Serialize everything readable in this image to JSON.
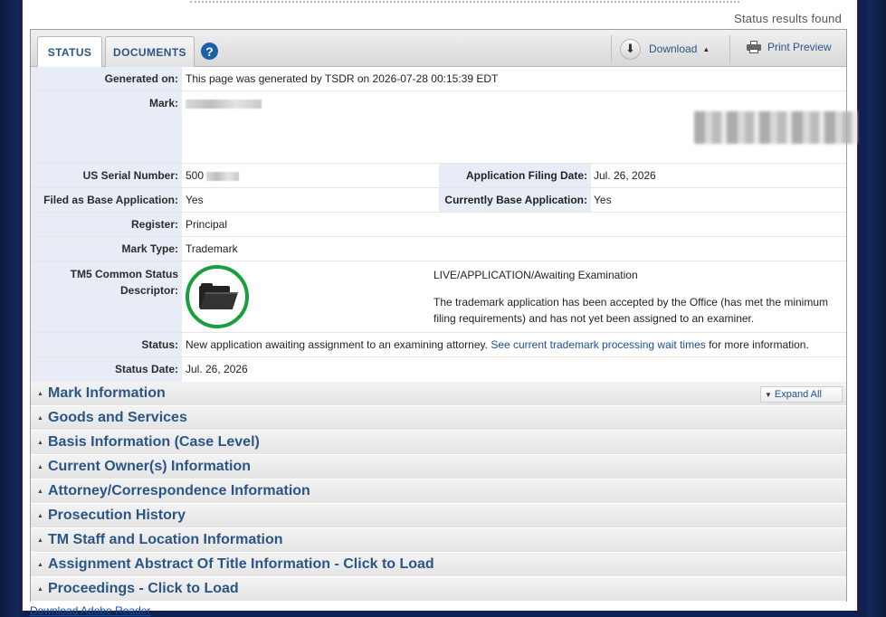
{
  "header": {
    "status_results": "Status results found"
  },
  "tabs": {
    "status": "STATUS",
    "documents": "DOCUMENTS",
    "help": "?"
  },
  "toolbar": {
    "download": "Download",
    "print_preview": "Print Preview"
  },
  "fields": {
    "generated_label": "Generated on:",
    "generated_value": "This page was generated by TSDR on 2026-07-28 00:15:39 EDT",
    "mark_label": "Mark:",
    "serial_label": "US Serial Number:",
    "serial_value": "500",
    "filing_date_label": "Application Filing Date:",
    "filing_date_value": "Jul. 26, 2026",
    "filed_base_label": "Filed as Base Application:",
    "filed_base_value": "Yes",
    "currently_base_label": "Currently Base Application:",
    "currently_base_value": "Yes",
    "register_label": "Register:",
    "register_value": "Principal",
    "mark_type_label": "Mark Type:",
    "mark_type_value": "Trademark",
    "tm5_label_line1": "TM5 Common Status",
    "tm5_label_line2": "Descriptor:",
    "tm5_status": "LIVE/APPLICATION/Awaiting Examination",
    "tm5_description": "The trademark application has been accepted by the Office (has met the minimum filing requirements) and has not yet been assigned to an examiner.",
    "status_label": "Status:",
    "status_text": "New application awaiting assignment to an examining attorney.",
    "status_link": "See current trademark processing wait times",
    "status_suffix": "for more information.",
    "status_date_label": "Status Date:",
    "status_date_value": "Jul. 26, 2026"
  },
  "expand_all": "Expand All",
  "sections": [
    {
      "title": "Mark Information"
    },
    {
      "title": "Goods and Services"
    },
    {
      "title": "Basis Information (Case Level)"
    },
    {
      "title": "Current Owner(s) Information"
    },
    {
      "title": "Attorney/Correspondence Information"
    },
    {
      "title": "Prosecution History"
    },
    {
      "title": "TM Staff and Location Information"
    },
    {
      "title": "Assignment Abstract Of Title Information - Click to Load"
    },
    {
      "title": "Proceedings - Click to Load"
    }
  ],
  "footer": {
    "link": "Download Adobe Reader"
  },
  "colors": {
    "accent": "#2a5685",
    "link": "#1a4fa0",
    "label_bg": "#e8ecf7",
    "tm5_ring": "#15a03b"
  }
}
